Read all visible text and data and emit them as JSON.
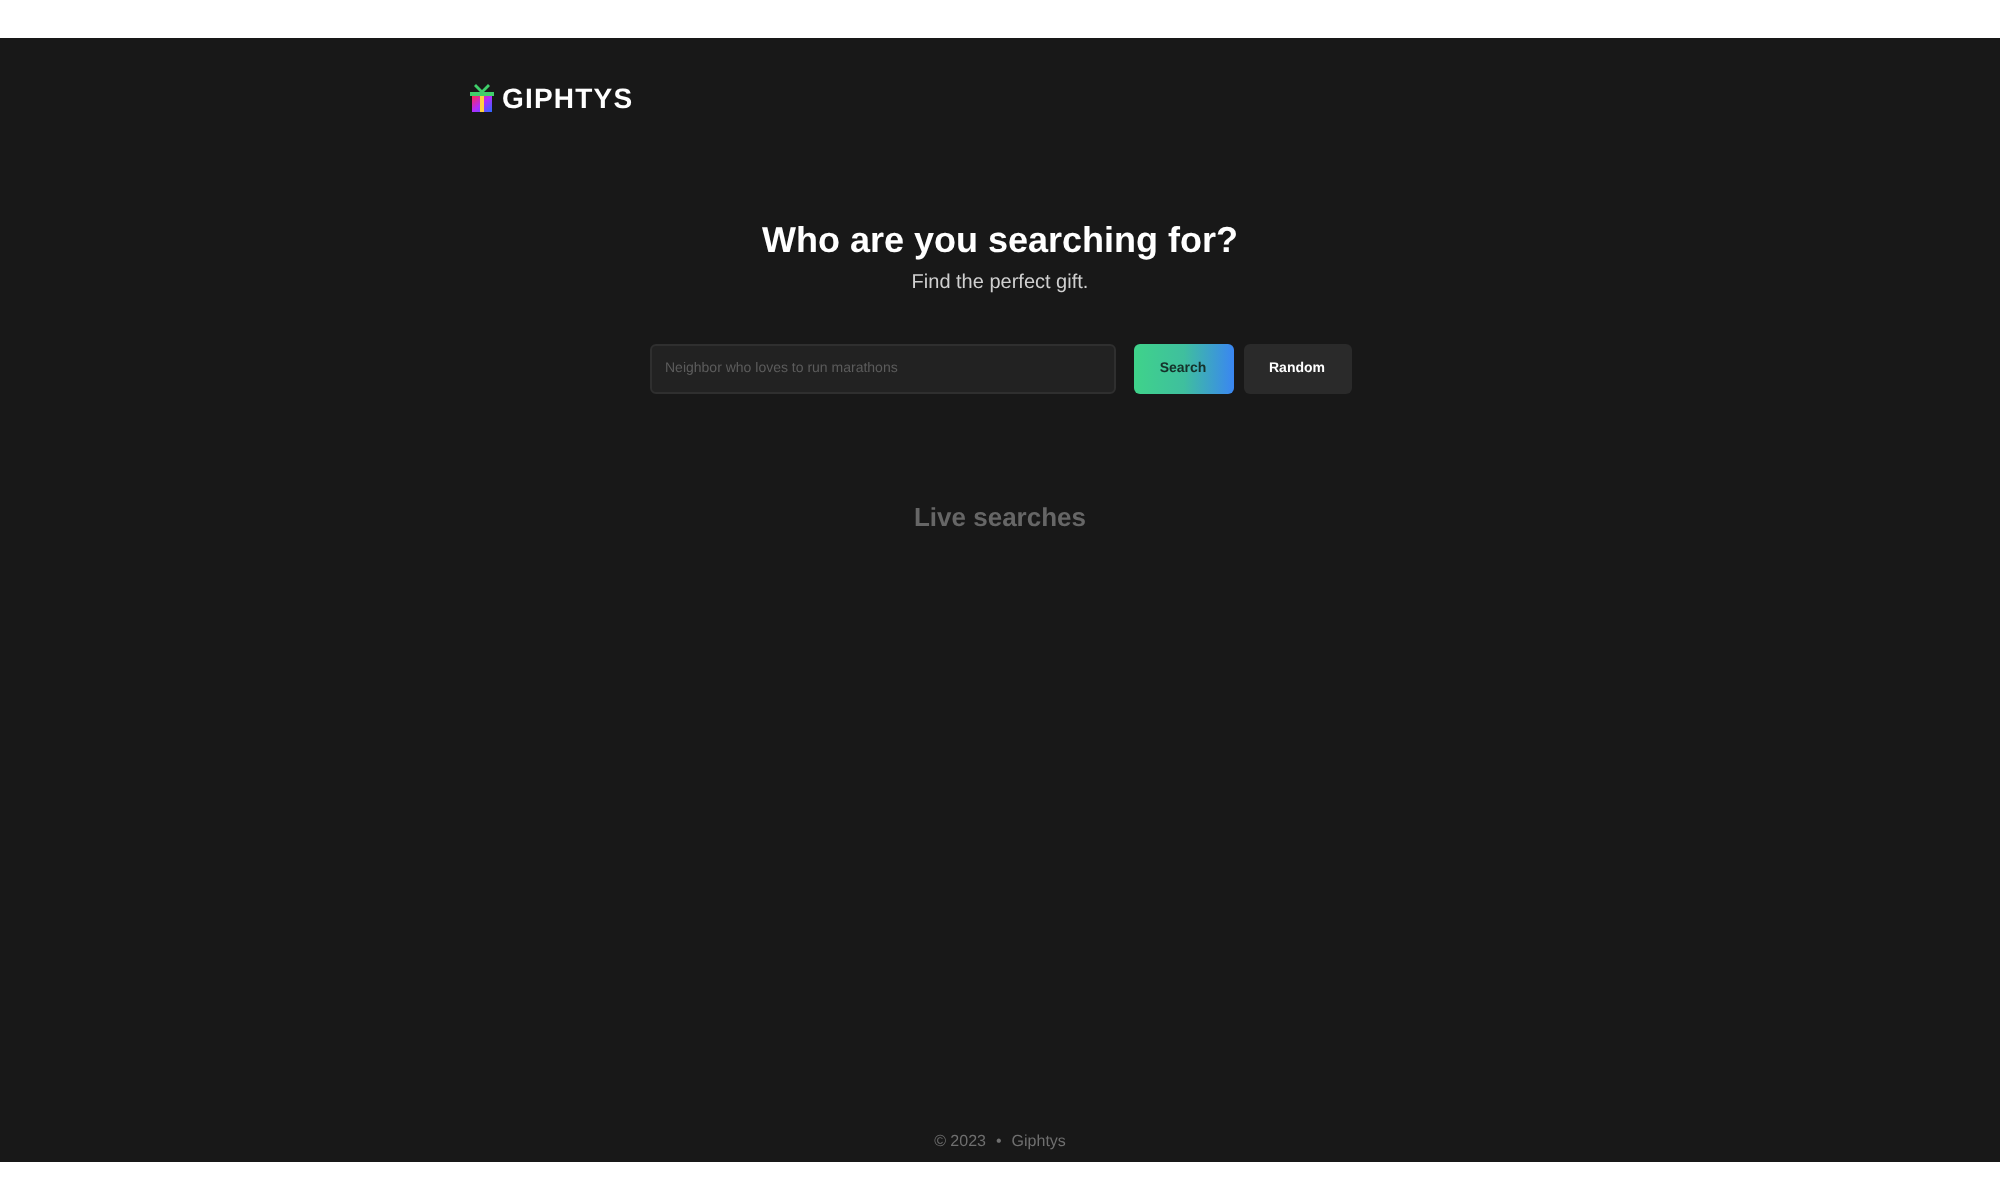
{
  "header": {
    "logo_text": "GIPHTYS"
  },
  "hero": {
    "title": "Who are you searching for?",
    "subtitle": "Find the perfect gift."
  },
  "search": {
    "placeholder": "Neighbor who loves to run marathons",
    "buttons": [
      {
        "label": "Search",
        "kind": "primary"
      },
      {
        "label": "Random",
        "kind": "secondary"
      }
    ]
  },
  "live_searches": {
    "heading": "Live searches"
  },
  "footer": {
    "items": [
      "© 2023",
      "•",
      "Giphtys"
    ]
  }
}
